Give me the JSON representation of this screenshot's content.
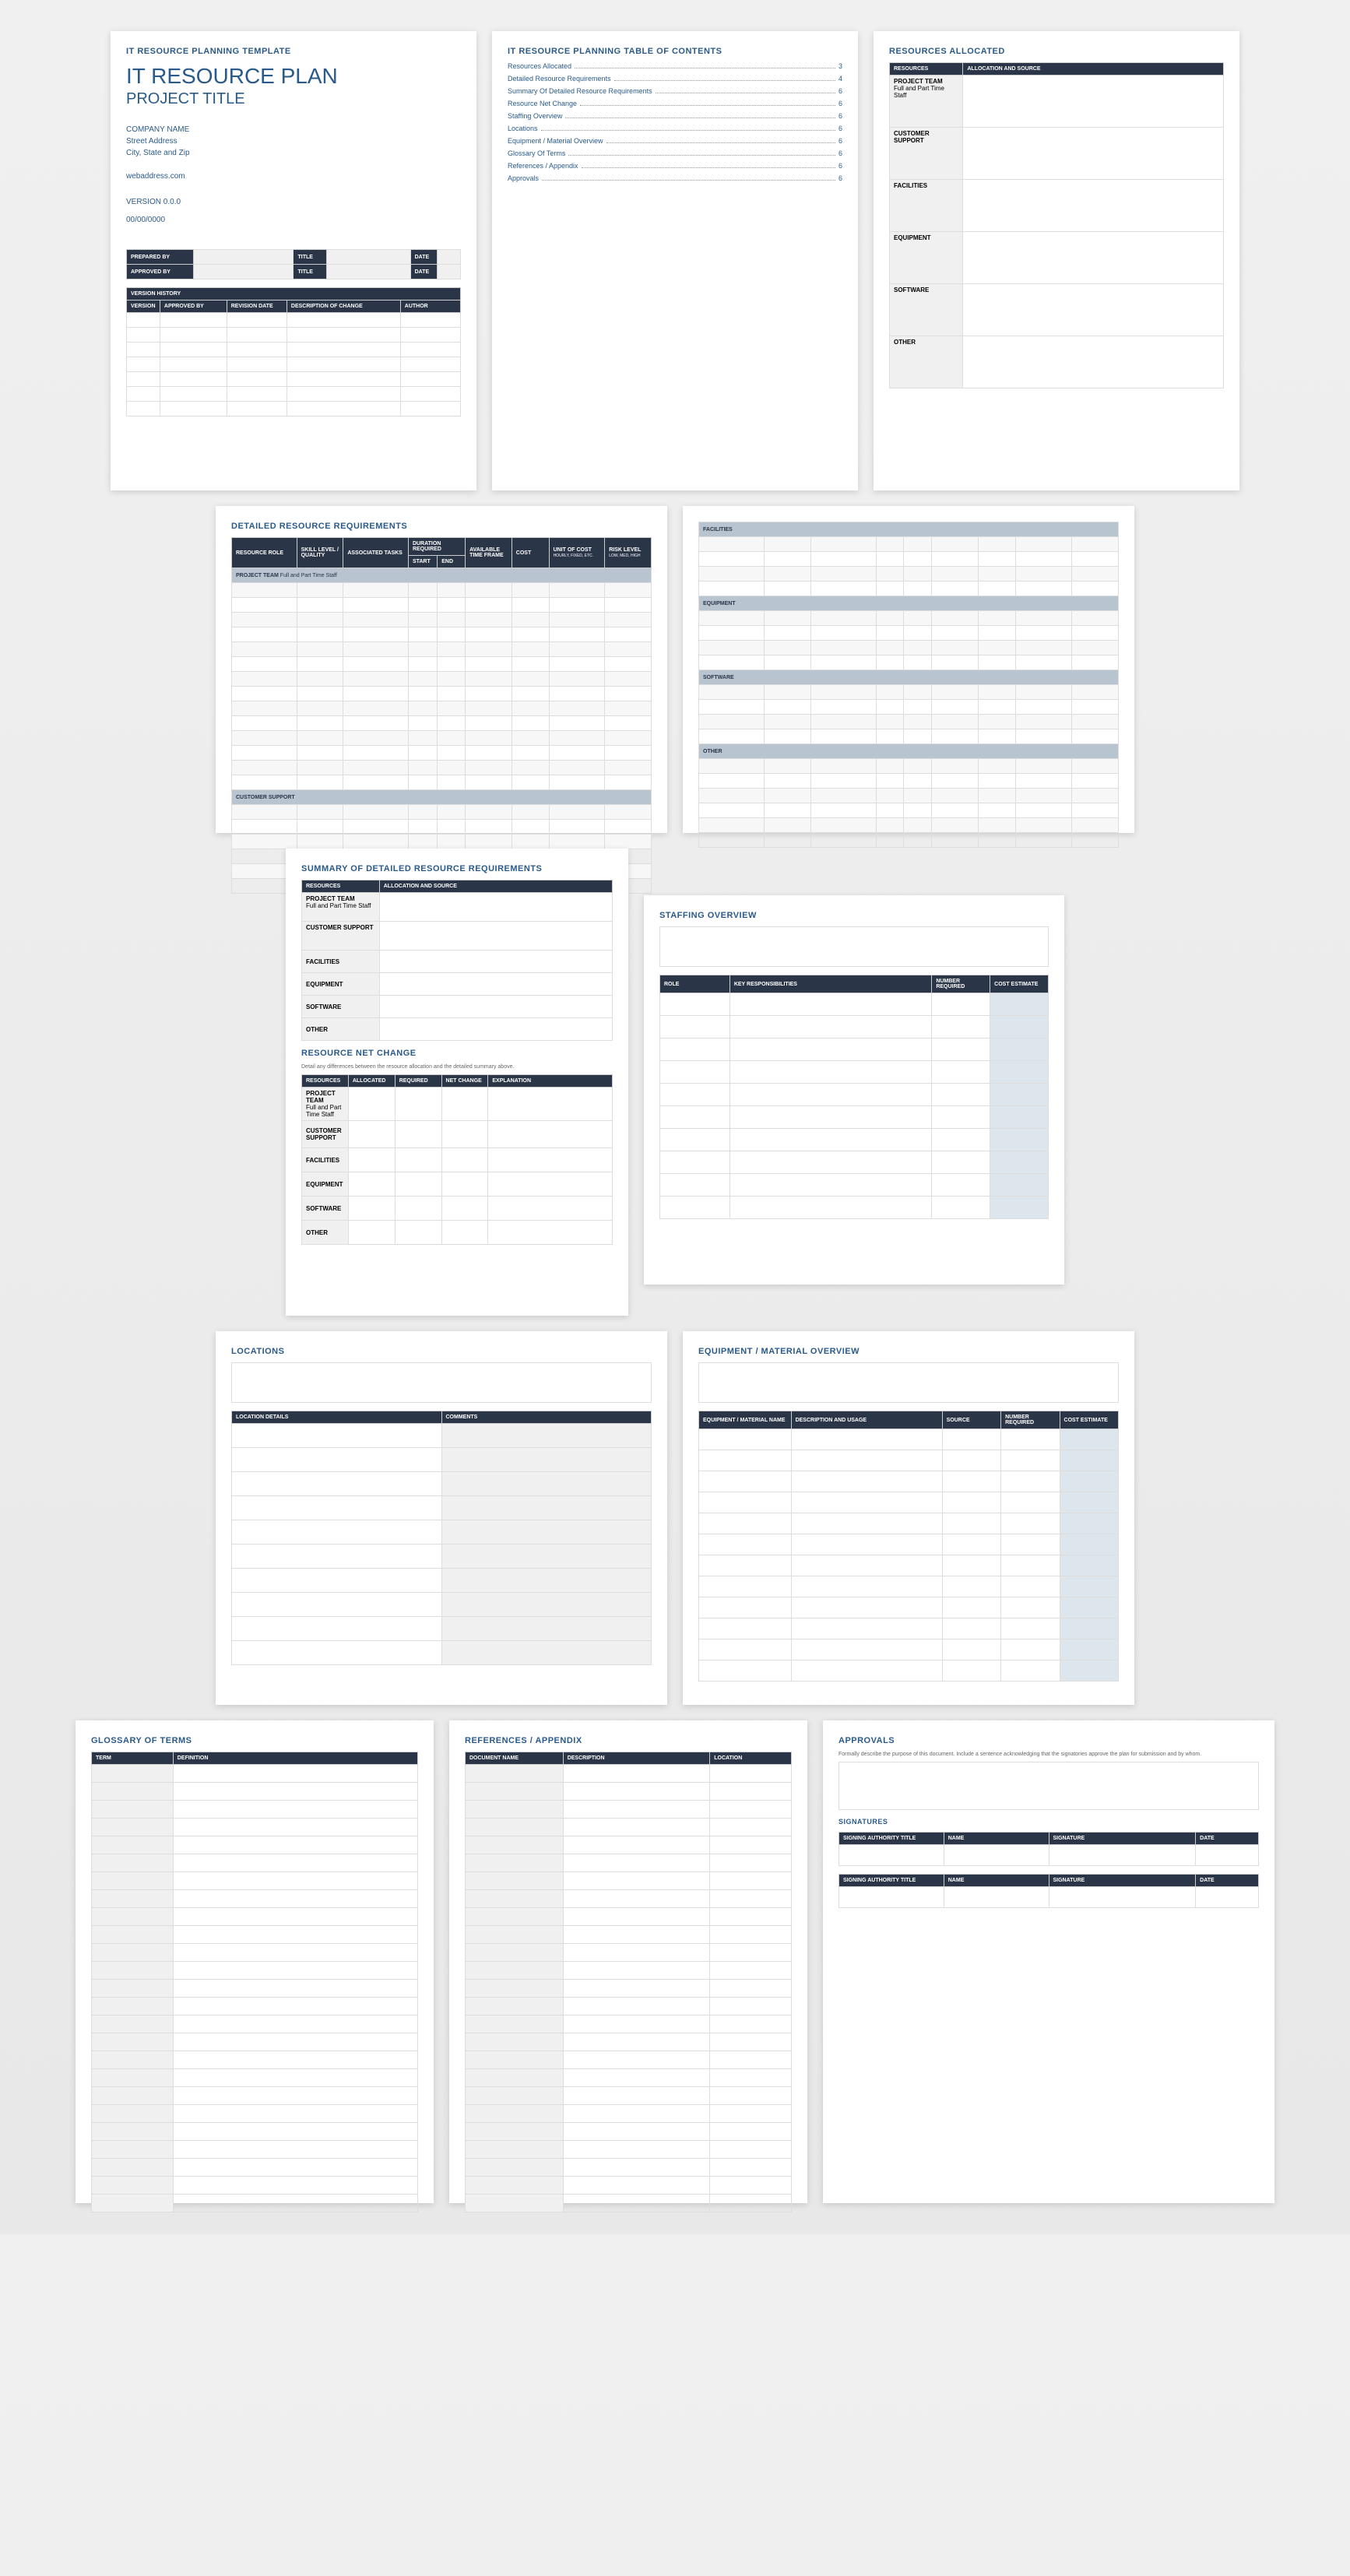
{
  "template_label": "IT RESOURCE PLANNING TEMPLATE",
  "main_title": "IT RESOURCE PLAN",
  "subtitle": "PROJECT TITLE",
  "company": {
    "name": "COMPANY NAME",
    "street": "Street Address",
    "citystate": "City, State and Zip",
    "web": "webaddress.com"
  },
  "version": "VERSION 0.0.0",
  "date": "00/00/0000",
  "prep": {
    "prepared_by": "PREPARED BY",
    "approved_by": "APPROVED BY",
    "title": "TITLE",
    "date_label": "DATE"
  },
  "vh": {
    "heading": "VERSION HISTORY",
    "version": "VERSION",
    "approved_by": "APPROVED BY",
    "rev_date": "REVISION DATE",
    "desc": "DESCRIPTION OF CHANGE",
    "author": "AUTHOR"
  },
  "toc": {
    "title": "IT RESOURCE PLANNING TABLE OF CONTENTS",
    "items": [
      {
        "label": "Resources Allocated",
        "page": "3"
      },
      {
        "label": "Detailed Resource Requirements",
        "page": "4"
      },
      {
        "label": "Summary Of Detailed Resource Requirements",
        "page": "6"
      },
      {
        "label": "Resource Net Change",
        "page": "6"
      },
      {
        "label": "Staffing Overview",
        "page": "6"
      },
      {
        "label": "Locations",
        "page": "6"
      },
      {
        "label": "Equipment / Material Overview",
        "page": "6"
      },
      {
        "label": "Glossary Of Terms",
        "page": "6"
      },
      {
        "label": "References / Appendix",
        "page": "6"
      },
      {
        "label": "Approvals",
        "page": "6"
      }
    ]
  },
  "resources_allocated": {
    "title": "RESOURCES ALLOCATED",
    "col1": "RESOURCES",
    "col2": "ALLOCATION AND SOURCE",
    "rows": [
      {
        "label": "PROJECT TEAM",
        "sub": "Full and Part Time Staff"
      },
      {
        "label": "CUSTOMER SUPPORT",
        "sub": ""
      },
      {
        "label": "FACILITIES",
        "sub": ""
      },
      {
        "label": "EQUIPMENT",
        "sub": ""
      },
      {
        "label": "SOFTWARE",
        "sub": ""
      },
      {
        "label": "OTHER",
        "sub": ""
      }
    ]
  },
  "detailed": {
    "title": "DETAILED RESOURCE REQUIREMENTS",
    "h": {
      "role": "RESOURCE ROLE",
      "skill": "SKILL LEVEL / QUALITY",
      "tasks": "ASSOCIATED TASKS",
      "duration": "DURATION REQUIRED",
      "start": "START",
      "end": "END",
      "avail": "AVAILABLE TIME FRAME",
      "cost": "COST",
      "unit": "UNIT OF COST",
      "unit_sub": "Hourly, Fixed, etc.",
      "risk": "RISK LEVEL",
      "risk_sub": "Low, Med, High"
    },
    "sections": [
      "PROJECT TEAM",
      "CUSTOMER SUPPORT",
      "FACILITIES",
      "EQUIPMENT",
      "SOFTWARE",
      "OTHER"
    ],
    "sub_project": "Full and Part Time Staff"
  },
  "summary": {
    "title": "SUMMARY OF DETAILED RESOURCE REQUIREMENTS",
    "col1": "RESOURCES",
    "col2": "ALLOCATION AND SOURCE"
  },
  "net_change": {
    "title": "RESOURCE NET CHANGE",
    "note": "Detail any differences between the resource allocation and the detailed summary above.",
    "h": {
      "res": "RESOURCES",
      "alloc": "ALLOCATED",
      "req": "REQUIRED",
      "net": "NET CHANGE",
      "exp": "EXPLANATION"
    }
  },
  "staffing": {
    "title": "STAFFING OVERVIEW",
    "h": {
      "role": "ROLE",
      "resp": "KEY RESPONSIBILITIES",
      "num": "NUMBER REQUIRED",
      "cost": "COST ESTIMATE"
    }
  },
  "locations": {
    "title": "LOCATIONS",
    "h": {
      "details": "LOCATION DETAILS",
      "comments": "COMMENTS"
    }
  },
  "equipment": {
    "title": "EQUIPMENT / MATERIAL OVERVIEW",
    "h": {
      "name": "EQUIPMENT / MATERIAL NAME",
      "desc": "DESCRIPTION AND USAGE",
      "source": "SOURCE",
      "num": "NUMBER REQUIRED",
      "cost": "COST ESTIMATE"
    }
  },
  "glossary": {
    "title": "GLOSSARY OF TERMS",
    "h": {
      "term": "TERM",
      "def": "DEFINITION"
    }
  },
  "references": {
    "title": "REFERENCES / APPENDIX",
    "h": {
      "name": "DOCUMENT NAME",
      "desc": "DESCRIPTION",
      "loc": "LOCATION"
    }
  },
  "approvals": {
    "title": "APPROVALS",
    "note": "Formally describe the purpose of this document. Include a sentence acknowledging that the signatories approve the plan for submission and by whom.",
    "sig_title": "SIGNATURES",
    "h": {
      "auth": "SIGNING AUTHORITY TITLE",
      "name": "NAME",
      "sig": "SIGNATURE",
      "date": "DATE"
    }
  }
}
